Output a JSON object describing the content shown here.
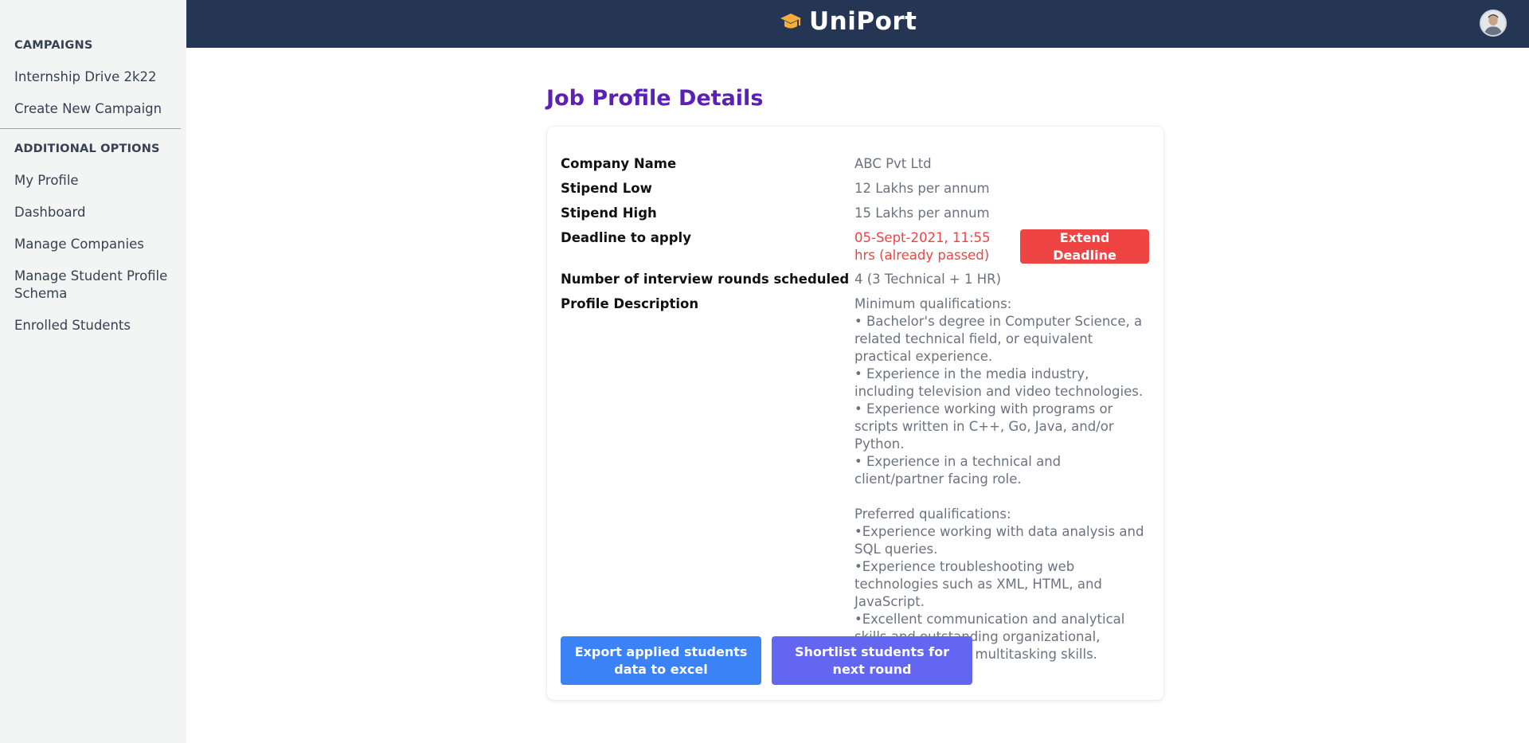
{
  "app": {
    "brand": "UniPort"
  },
  "sidebar": {
    "campaigns_heading": "CAMPAIGNS",
    "campaign_items": [
      "Internship Drive 2k22",
      "Create New Campaign"
    ],
    "options_heading": "ADDITIONAL OPTIONS",
    "option_items": [
      "My Profile",
      "Dashboard",
      "Manage Companies",
      "Manage Student Profile Schema",
      "Enrolled Students"
    ]
  },
  "page": {
    "title": "Job Profile Details"
  },
  "details": {
    "company_name": {
      "label": "Company Name",
      "value": "ABC Pvt Ltd"
    },
    "stipend_low": {
      "label": "Stipend Low",
      "value": "12 Lakhs per annum"
    },
    "stipend_high": {
      "label": "Stipend High",
      "value": "15 Lakhs per annum"
    },
    "deadline": {
      "label": "Deadline to apply",
      "value": "05-Sept-2021, 11:55 hrs (already passed)",
      "color": "#ef4444"
    },
    "rounds": {
      "label": "Number of interview rounds scheduled",
      "value": "4 (3 Technical + 1 HR)"
    },
    "description": {
      "label": "Profile Description",
      "value": "Minimum qualifications:\n• Bachelor's degree in Computer Science, a related technical field, or equivalent practical experience.\n• Experience in the media industry, including television and video technologies.\n• Experience working with programs or scripts written in C++, Go, Java, and/or Python.\n• Experience in a technical and client/partner facing role.\n\nPreferred qualifications:\n•Experience working with data analysis and SQL queries.\n•Experience troubleshooting web technologies such as XML, HTML, and JavaScript.\n•Excellent communication and analytical skills and outstanding organizational, prioritization, and multitasking skills."
    }
  },
  "actions": {
    "extend_deadline": "Extend Deadline",
    "export": "Export applied students data to excel",
    "shortlist": "Shortlist students for next round"
  },
  "colors": {
    "topbar": "#243654",
    "title": "#5b21b6",
    "danger": "#ef4444",
    "primary": "#3b82f6",
    "indigo": "#6366f1"
  },
  "icons": {
    "logo": "graduation-cap-icon",
    "avatar": "user-avatar"
  }
}
